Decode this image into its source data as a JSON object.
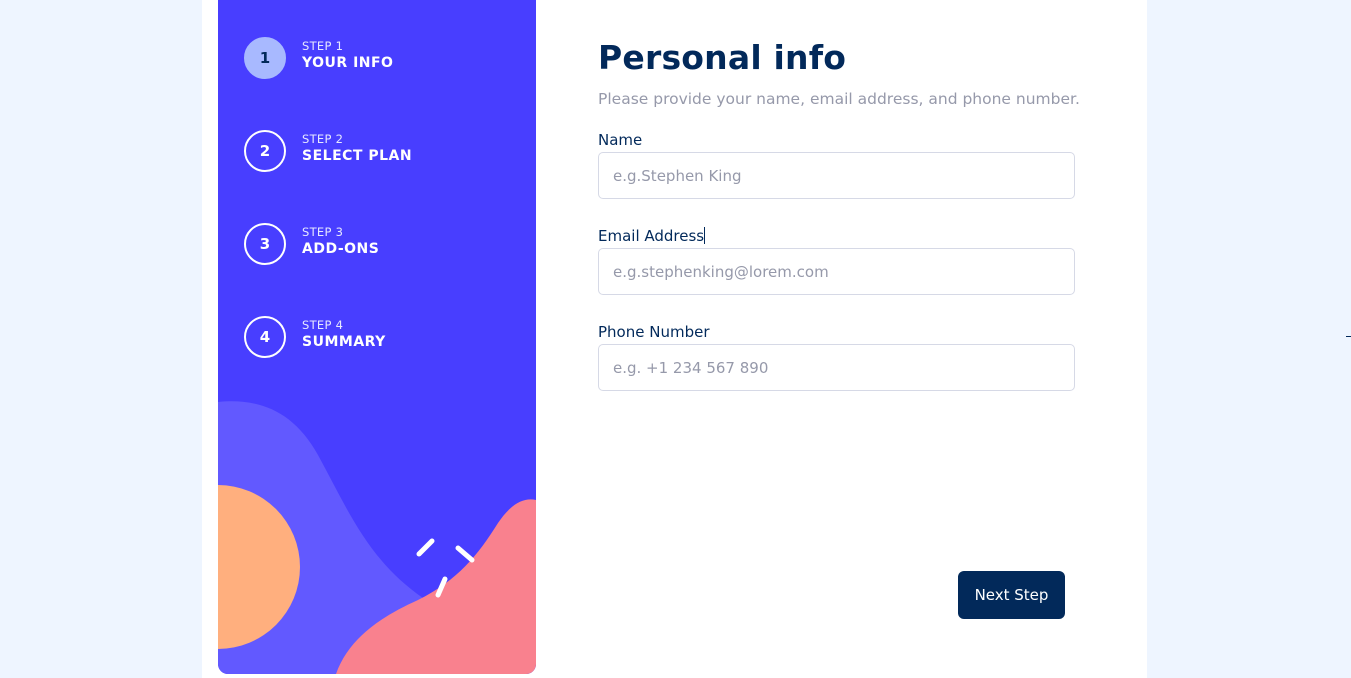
{
  "sidebar": {
    "steps": [
      {
        "label": "STEP 1",
        "title": "YOUR INFO",
        "number": "1",
        "active": true
      },
      {
        "label": "STEP 2",
        "title": "SELECT PLAN",
        "number": "2",
        "active": false
      },
      {
        "label": "STEP 3",
        "title": "ADD-ONS",
        "number": "3",
        "active": false
      },
      {
        "label": "STEP 4",
        "title": "SUMMARY",
        "number": "4",
        "active": false
      }
    ],
    "colors": {
      "background": "#483eff",
      "wave": "#6259ff",
      "circle": "#ffaf7e",
      "blob": "#f9818e",
      "active_step": "#a8b9ff"
    }
  },
  "form": {
    "title": "Personal info",
    "subtitle": "Please provide your name, email address, and phone number.",
    "fields": {
      "name": {
        "label": "Name",
        "placeholder": "e.g.Stephen King",
        "value": ""
      },
      "email": {
        "label": "Email Address",
        "placeholder": "e.g.stephenking@lorem.com",
        "value": ""
      },
      "phone": {
        "label": "Phone Number",
        "placeholder": "e.g. +1 234 567 890",
        "value": ""
      }
    },
    "next_label": "Next Step"
  },
  "theme": {
    "page_background": "#eef5ff",
    "primary_text": "#02295a",
    "muted_text": "#9699aa",
    "border": "#d6d9e6"
  }
}
